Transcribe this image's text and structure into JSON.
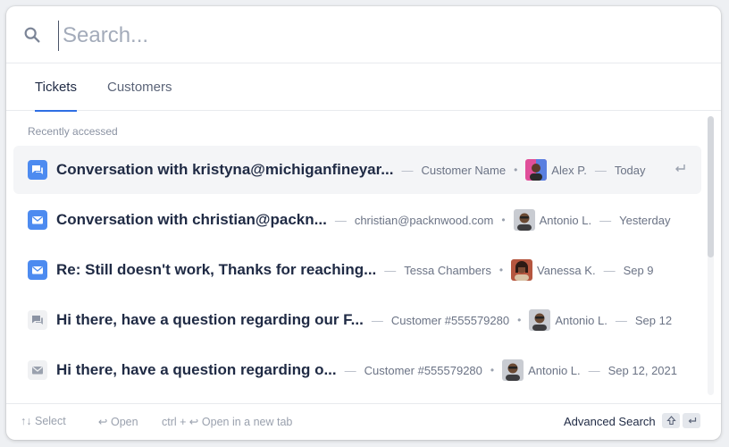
{
  "search": {
    "placeholder": "Search..."
  },
  "tabs": [
    {
      "label": "Tickets",
      "active": true
    },
    {
      "label": "Customers",
      "active": false
    }
  ],
  "section_label": "Recently accessed",
  "rows": [
    {
      "icon": "chat-icon",
      "icon_style": "blue",
      "title": "Conversation with kristyna@michiganfineyar...",
      "meta": "Customer Name",
      "agent": "Alex P.",
      "date": "Today",
      "selected": true
    },
    {
      "icon": "mail-icon",
      "icon_style": "blue",
      "title": "Conversation with christian@packn...",
      "meta": "christian@packnwood.com",
      "agent": "Antonio L.",
      "date": "Yesterday",
      "selected": false
    },
    {
      "icon": "mail-icon",
      "icon_style": "blue",
      "title": "Re: Still doesn't work, Thanks for reaching...",
      "meta": "Tessa Chambers",
      "agent": "Vanessa K.",
      "date": "Sep 9",
      "selected": false
    },
    {
      "icon": "chat-icon",
      "icon_style": "grey",
      "title": "Hi there, have a question regarding our F...",
      "meta": "Customer #555579280",
      "agent": "Antonio L.",
      "date": "Sep 12",
      "selected": false
    },
    {
      "icon": "mail-icon",
      "icon_style": "grey",
      "title": "Hi there, have a question regarding o...",
      "meta": "Customer #555579280",
      "agent": "Antonio L.",
      "date": "Sep 12, 2021",
      "selected": false
    }
  ],
  "footer": {
    "select_hint": "Select",
    "open_hint": "Open",
    "new_tab_prefix": "ctrl +",
    "new_tab_hint": "Open in a new tab",
    "advanced_search": "Advanced Search"
  },
  "colors": {
    "accent": "#2f6fe4",
    "icon_blue": "#4d8bf0",
    "selected_row": "#f4f5f7"
  }
}
